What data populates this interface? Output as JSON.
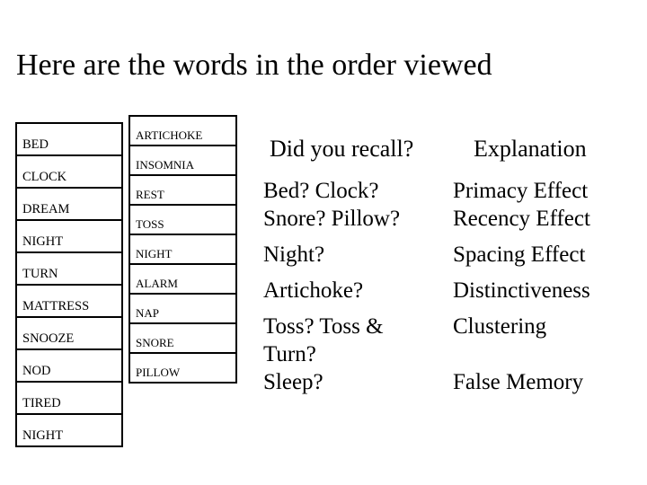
{
  "slide": {
    "title": "Here are the words in the order viewed"
  },
  "word_list_1": [
    "BED",
    "CLOCK",
    "DREAM",
    "NIGHT",
    "TURN",
    "MATTRESS",
    "SNOOZE",
    "NOD",
    "TIRED",
    "NIGHT"
  ],
  "word_list_2": [
    "ARTICHOKE",
    "INSOMNIA",
    "REST",
    "TOSS",
    "NIGHT",
    "ALARM",
    "NAP",
    "SNORE",
    "PILLOW"
  ],
  "recall_table": {
    "header_question": "Did you recall?",
    "header_explanation": "Explanation",
    "rows": [
      {
        "question": "Bed? Clock?",
        "explanation": "Primacy Effect"
      },
      {
        "question": "Snore? Pillow?",
        "explanation": "Recency Effect"
      },
      {
        "question": "Night?",
        "explanation": "Spacing Effect"
      },
      {
        "question": "Artichoke?",
        "explanation": "Distinctiveness"
      },
      {
        "question": "Toss? Toss &",
        "explanation": "Clustering"
      },
      {
        "question": "Turn?",
        "explanation": ""
      },
      {
        "question": "Sleep?",
        "explanation": "False Memory"
      }
    ]
  },
  "colors": {
    "background": "#ffffff",
    "text": "#000000",
    "table_border": "#000000"
  }
}
